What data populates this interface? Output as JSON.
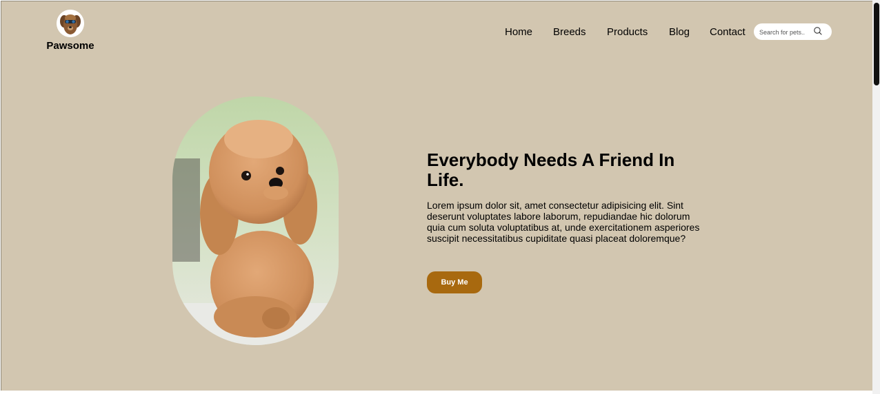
{
  "brand": {
    "name": "Pawsome",
    "logo_icon": "dog-face-icon"
  },
  "nav": {
    "items": [
      {
        "label": "Home"
      },
      {
        "label": "Breeds"
      },
      {
        "label": "Products"
      },
      {
        "label": "Blog"
      },
      {
        "label": "Contact"
      }
    ]
  },
  "search": {
    "placeholder": "Search for pets..",
    "value": "",
    "icon": "search-icon"
  },
  "hero": {
    "image": "puppy-photo",
    "title": "Everybody Needs A Friend In Life.",
    "text": "Lorem ipsum dolor sit, amet consectetur adipisicing elit. Sint deserunt voluptates labore laborum, repudiandae hic dolorum quia cum soluta voluptatibus at, unde exercitationem asperiores suscipit necessitatibus cupiditate quasi placeat doloremque?",
    "button_label": "Buy Me"
  },
  "colors": {
    "page_background": "#d2c6b0",
    "button": "#a8690f",
    "text": "#000000"
  }
}
